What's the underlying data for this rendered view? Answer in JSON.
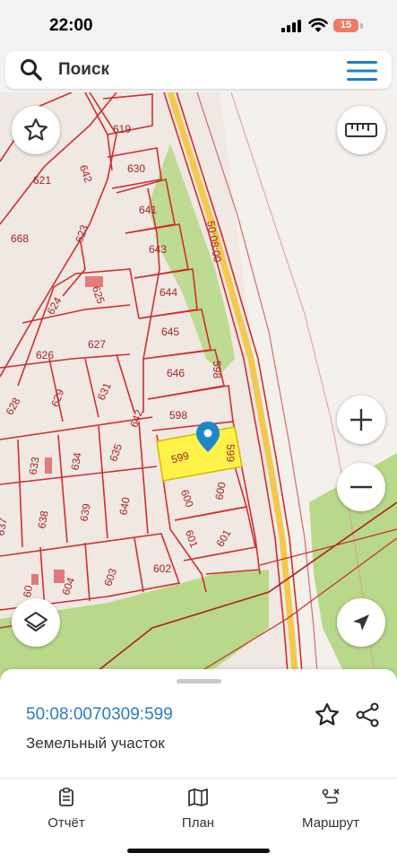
{
  "status_bar": {
    "time": "22:00",
    "battery": "15"
  },
  "search": {
    "placeholder": "Поиск"
  },
  "map": {
    "plot_labels": [
      "619",
      "630",
      "621",
      "641",
      "642",
      "643",
      "668",
      "623",
      "644",
      "625",
      "624",
      "645",
      "627",
      "626",
      "646",
      "631",
      "629",
      "628",
      "642",
      "598",
      "598",
      "599",
      "599",
      "635",
      "634",
      "633",
      "640",
      "639",
      "638",
      "637",
      "600",
      "600",
      "601",
      "601",
      "602",
      "603",
      "604",
      "60",
      "50:08:00"
    ],
    "selected_plot_color": "#fff34a",
    "boundary_color": "#d42b2b",
    "marker_color": "#1f86c9"
  },
  "parcel": {
    "cadastral_number": "50:08:0070309:599",
    "type": "Земельный участок"
  },
  "tabs": [
    {
      "label": "Отчёт",
      "icon": "report-icon"
    },
    {
      "label": "План",
      "icon": "map-plan-icon"
    },
    {
      "label": "Маршрут",
      "icon": "route-icon"
    }
  ]
}
